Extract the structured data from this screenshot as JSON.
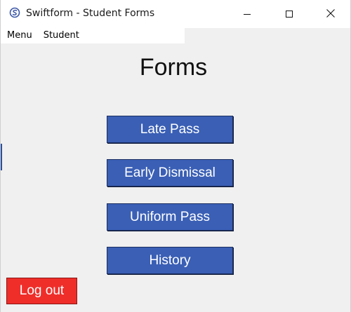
{
  "window": {
    "title": "Swiftform - Student Forms",
    "icon": "swiftform-logo-icon",
    "controls": [
      "minimize-icon",
      "maximize-icon",
      "close-icon"
    ]
  },
  "menubar": {
    "items": [
      {
        "label": "Menu"
      },
      {
        "label": "Student"
      }
    ]
  },
  "main": {
    "title": "Forms",
    "buttons": [
      {
        "label": "Late Pass"
      },
      {
        "label": "Early Dismissal"
      },
      {
        "label": "Uniform Pass"
      },
      {
        "label": "History"
      }
    ],
    "logout_label": "Log out"
  },
  "colors": {
    "primary_button": "#3a5fb5",
    "logout_button": "#ef2e2a",
    "background": "#f0f0f0"
  }
}
